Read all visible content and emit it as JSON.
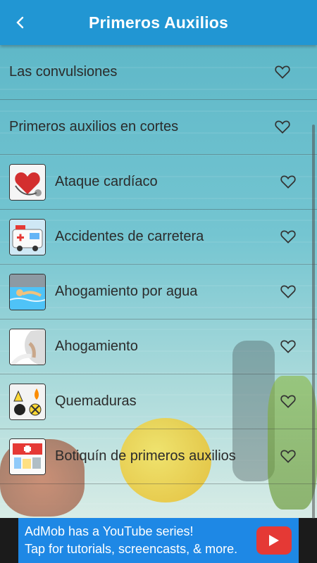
{
  "header": {
    "title": "Primeros Auxilios",
    "back_icon": "back-arrow-icon"
  },
  "items": [
    {
      "label": "Las convulsiones",
      "thumb": null
    },
    {
      "label": "Primeros auxilios en cortes",
      "thumb": null
    },
    {
      "label": "Ataque cardíaco",
      "thumb": "heart-stethoscope"
    },
    {
      "label": "Accidentes de carretera",
      "thumb": "ambulance"
    },
    {
      "label": "Ahogamiento por agua",
      "thumb": "swimmer"
    },
    {
      "label": "Ahogamiento",
      "thumb": "choking-person"
    },
    {
      "label": "Quemaduras",
      "thumb": "burn-hazard"
    },
    {
      "label": "Botiquín de primeros auxilios",
      "thumb": "first-aid-kit"
    }
  ],
  "ad": {
    "line1": "AdMob has a YouTube series!",
    "line2": "Tap for tutorials, screencasts, & more."
  },
  "colors": {
    "appbar": "#2196d3",
    "ad": "#1e88e5",
    "youtube": "#e53935"
  }
}
